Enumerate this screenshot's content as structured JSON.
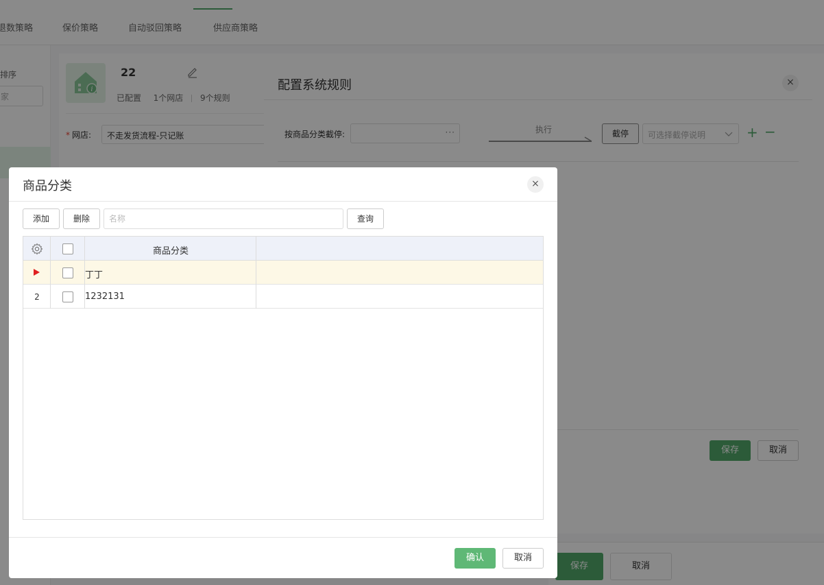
{
  "tabs": [
    {
      "label": "退数策略"
    },
    {
      "label": "保价策略"
    },
    {
      "label": "自动驳回策略"
    },
    {
      "label": "供应商策略"
    }
  ],
  "left_panel": {
    "label": "排序",
    "input_value": "家"
  },
  "shop_card": {
    "name": "22",
    "status": "已配置",
    "shop_count": "1个网店",
    "rule_count": "9个规则",
    "field_label": "网店:",
    "field_value": "不走发货流程-只记账"
  },
  "bottom_bar": {
    "save": "保存",
    "cancel": "取消"
  },
  "rule_dialog": {
    "title": "配置系统规则",
    "close": "×",
    "category_label": "按商品分类截停:",
    "category_value": "",
    "dots": "···",
    "exec_label": "执行",
    "pause_button": "截停",
    "pause_placeholder": "可选择截停说明",
    "add": "+",
    "remove": "−",
    "save": "保存",
    "cancel": "取消"
  },
  "category_dialog": {
    "title": "商品分类",
    "close": "×",
    "toolbar": {
      "add": "添加",
      "delete": "删除",
      "search_placeholder": "名称",
      "query": "查询"
    },
    "table": {
      "column_header": "商品分类",
      "rows": [
        {
          "row_number": "",
          "category": "丁丁",
          "selected": true
        },
        {
          "row_number": "2",
          "category": "1232131",
          "selected": false
        }
      ]
    },
    "footer": {
      "confirm": "确认",
      "cancel": "取消"
    }
  },
  "colors": {
    "accent": "#52a86a",
    "row_marker": "#e02020",
    "row_selected_bg": "#fdf8e6",
    "header_bg": "#eef1f9"
  }
}
